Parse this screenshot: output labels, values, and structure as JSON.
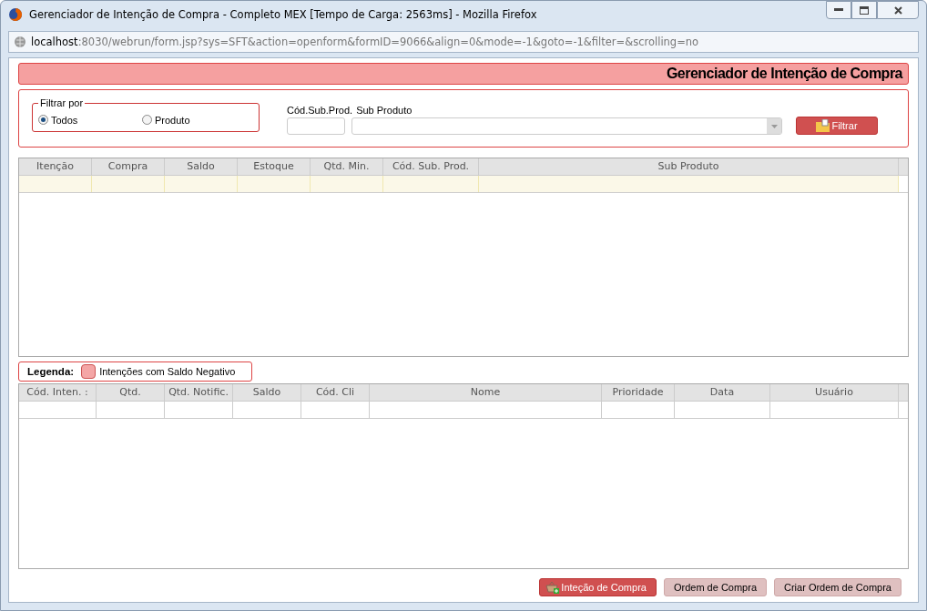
{
  "window": {
    "title": "Gerenciador de Intenção de Compra - Completo MEX [Tempo de Carga: 2563ms] - Mozilla Firefox",
    "url_host": "localhost",
    "url_rest": ":8030/webrun/form.jsp?sys=SFT&action=openform&formID=9066&align=0&mode=-1&goto=-1&filter=&scrolling=no"
  },
  "header": {
    "title": "Gerenciador de Intenção de Compra"
  },
  "filter": {
    "legend": "Filtrar por",
    "options": [
      {
        "label": "Todos",
        "selected": true
      },
      {
        "label": "Produto",
        "selected": false
      }
    ],
    "code_label": "Cód.Sub.Prod.",
    "product_label": "Sub Produto",
    "button": "Filtrar"
  },
  "grid_top": {
    "columns": [
      "Itenção",
      "Compra",
      "Saldo",
      "Estoque",
      "Qtd. Min.",
      "Cód. Sub. Prod.",
      "Sub Produto"
    ]
  },
  "legend": {
    "title": "Legenda:",
    "items": [
      {
        "label": "Intenções com Saldo Negativo",
        "color": "#f4a6a6"
      }
    ]
  },
  "grid_bottom": {
    "columns": [
      "Cód. Inten. :",
      "Qtd.",
      "Qtd. Notific.",
      "Saldo",
      "Cód. Cli",
      "Nome",
      "Prioridade",
      "Data",
      "Usuário"
    ]
  },
  "buttons": [
    {
      "label": "Inteção de Compra",
      "kind": "primary"
    },
    {
      "label": "Ordem de Compra",
      "kind": "secondary"
    },
    {
      "label": "Criar Ordem de Compra",
      "kind": "secondary"
    }
  ]
}
